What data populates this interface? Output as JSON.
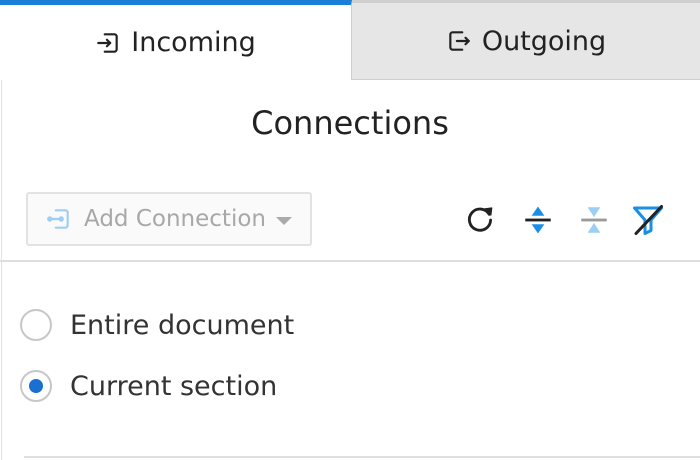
{
  "tabs": {
    "incoming": {
      "label": "Incoming",
      "icon": "sign-in-icon",
      "active": true
    },
    "outgoing": {
      "label": "Outgoing",
      "icon": "sign-out-icon",
      "active": false
    }
  },
  "panel": {
    "title": "Connections"
  },
  "toolbar": {
    "add_label": "Add Connection",
    "icons": [
      "refresh-icon",
      "expand-icon",
      "collapse-icon",
      "filter-off-icon"
    ]
  },
  "scope": {
    "options": [
      {
        "label": "Entire document",
        "checked": false
      },
      {
        "label": "Current section",
        "checked": true
      }
    ]
  },
  "colors": {
    "accent": "#1a7fd6",
    "icon_blue": "#1a8fe6",
    "icon_light": "#9ccff3"
  }
}
